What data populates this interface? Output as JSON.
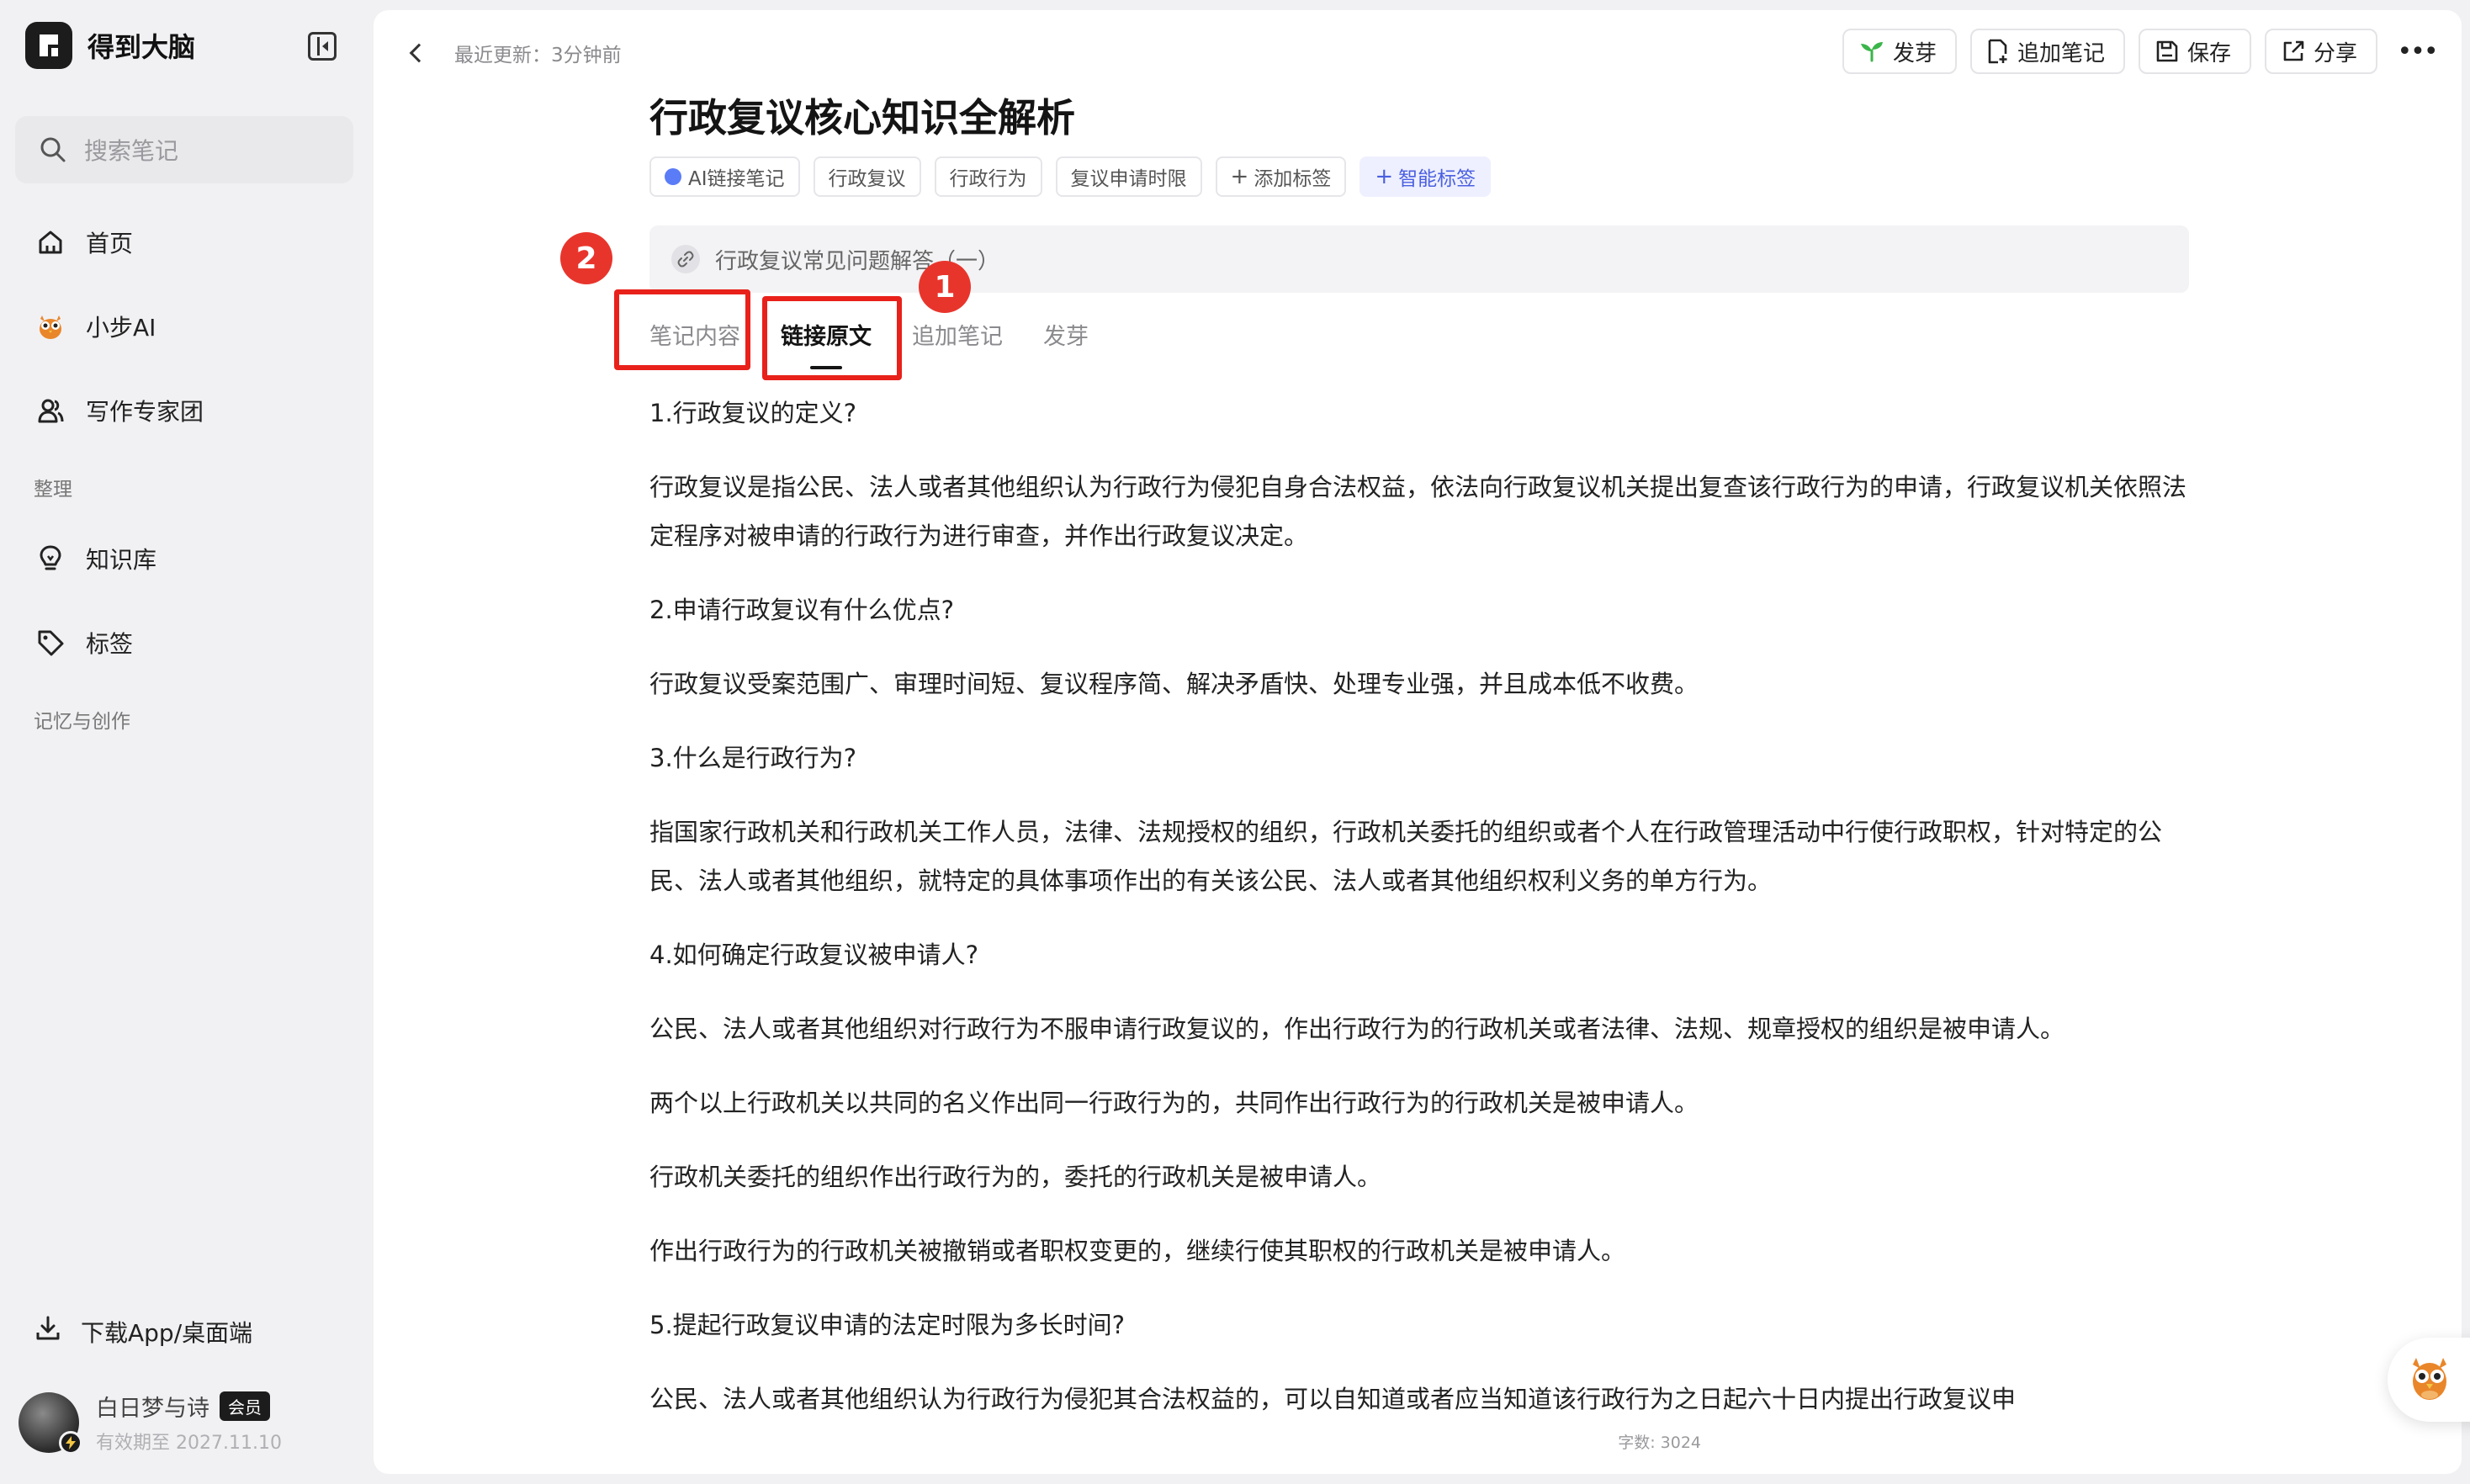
{
  "app": {
    "name": "得到大脑"
  },
  "sidebar": {
    "search_placeholder": "搜索笔记",
    "nav": [
      {
        "label": "首页"
      },
      {
        "label": "小步AI"
      },
      {
        "label": "写作专家团"
      }
    ],
    "section_organize": "整理",
    "organize_items": [
      {
        "label": "知识库"
      },
      {
        "label": "标签"
      }
    ],
    "section_memory": "记忆与创作",
    "download_label": "下载App/桌面端",
    "user": {
      "name": "白日梦与诗",
      "badge": "会员",
      "expiry": "有效期至 2027.11.10"
    }
  },
  "header": {
    "updated": "最近更新：3分钟前",
    "buttons": {
      "sprout": "发芽",
      "append": "追加笔记",
      "save": "保存",
      "share": "分享"
    }
  },
  "note": {
    "title": "行政复议核心知识全解析",
    "tags": [
      "AI链接笔记",
      "行政复议",
      "行政行为",
      "复议申请时限"
    ],
    "add_tag": "添加标签",
    "smart_tag": "智能标签",
    "link_title": "行政复议常见问题解答（一）",
    "tabs": [
      "笔记内容",
      "链接原文",
      "追加笔记",
      "发芽"
    ],
    "active_tab": "链接原文",
    "annotations": [
      "2",
      "1"
    ],
    "paragraphs": [
      "1.行政复议的定义?",
      "行政复议是指公民、法人或者其他组织认为行政行为侵犯自身合法权益，依法向行政复议机关提出复查该行政行为的申请，行政复议机关依照法定程序对被申请的行政行为进行审查，并作出行政复议决定。",
      "2.申请行政复议有什么优点?",
      "行政复议受案范围广、审理时间短、复议程序简、解决矛盾快、处理专业强，并且成本低不收费。",
      "3.什么是行政行为?",
      "指国家行政机关和行政机关工作人员，法律、法规授权的组织，行政机关委托的组织或者个人在行政管理活动中行使行政职权，针对特定的公民、法人或者其他组织，就特定的具体事项作出的有关该公民、法人或者其他组织权利义务的单方行为。",
      "4.如何确定行政复议被申请人?",
      "公民、法人或者其他组织对行政行为不服申请行政复议的，作出行政行为的行政机关或者法律、法规、规章授权的组织是被申请人。",
      "两个以上行政机关以共同的名义作出同一行政行为的，共同作出行政行为的行政机关是被申请人。",
      "行政机关委托的组织作出行政行为的，委托的行政机关是被申请人。",
      "作出行政行为的行政机关被撤销或者职权变更的，继续行使其职权的行政机关是被申请人。",
      "5.提起行政复议申请的法定时限为多长时间?",
      "公民、法人或者其他组织认为行政行为侵犯其合法权益的，可以自知道或者应当知道该行政行为之日起六十日内提出行政复议申"
    ],
    "word_count": "字数: 3024"
  },
  "colors": {
    "accent_red": "#e8211a",
    "smart_tag_blue": "#4a5fe0",
    "sprout_green": "#3bb54a"
  }
}
